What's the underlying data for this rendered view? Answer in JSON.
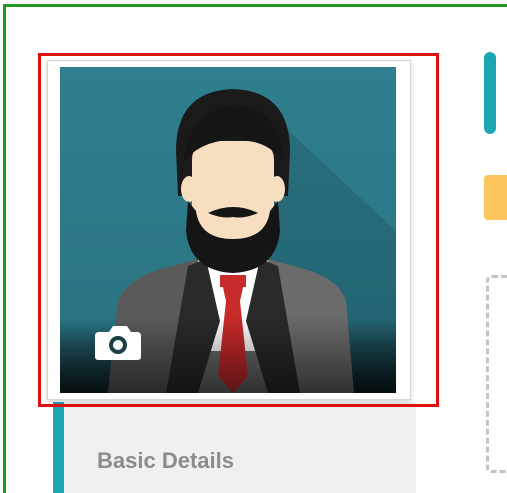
{
  "profile": {
    "section_label": "Basic Details"
  },
  "icons": {
    "photo_action": "camera-icon"
  },
  "colors": {
    "accent": "#1ba6b4",
    "photo_bg": "#2f7f8f",
    "tie": "#c92a2a",
    "warning": "#fbc45c"
  }
}
